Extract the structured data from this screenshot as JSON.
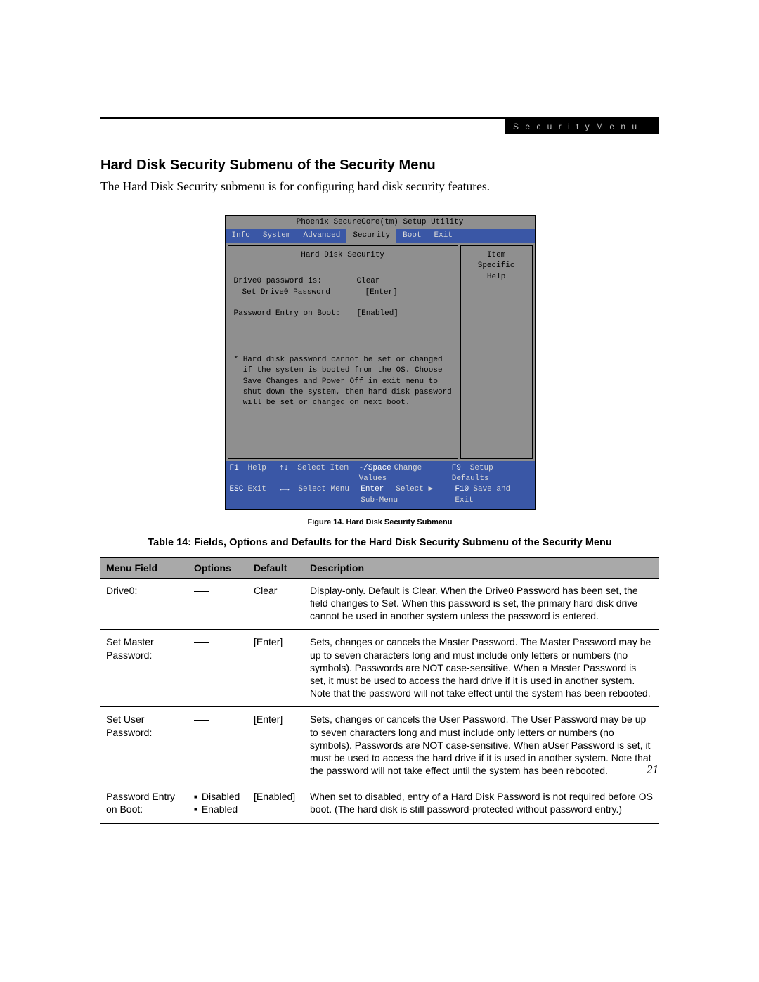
{
  "header_label": "S e c u r i t y   M e n u",
  "section_title": "Hard Disk Security Submenu of the Security Menu",
  "intro": "The Hard Disk Security submenu is for configuring hard disk security features.",
  "bios": {
    "utility_title": "Phoenix SecureCore(tm) Setup Utility",
    "tabs": [
      "Info",
      "System",
      "Advanced",
      "Security",
      "Boot",
      "Exit"
    ],
    "active_tab": "Security",
    "left_title": "Hard Disk Security",
    "right_title": "Item Specific Help",
    "rows": [
      {
        "label": "Drive0 password is:",
        "value": "Clear",
        "indent": 0
      },
      {
        "label": "Set Drive0 Password",
        "value": "[Enter]",
        "indent": 1
      },
      {
        "label": "",
        "value": "",
        "indent": 0
      },
      {
        "label": "Password Entry on Boot:",
        "value": "[Enabled]",
        "indent": 0
      }
    ],
    "note": [
      "* Hard disk password cannot be set or changed",
      "  if the system is booted from the OS. Choose",
      "  Save Changes and Power Off in exit menu to",
      "  shut down the system, then hard disk password",
      "  will be set or changed on next boot."
    ],
    "footer": {
      "r1": {
        "k1": "F1",
        "t1": "Help",
        "k2": "↑↓",
        "t2": "Select Item",
        "k3": "-/Space",
        "t3": "Change Values",
        "k4": "F9",
        "t4": "Setup Defaults"
      },
      "r2": {
        "k1": "ESC",
        "t1": "Exit",
        "k2": "←→",
        "t2": "Select Menu",
        "k3": "Enter",
        "t3": "Select ▶ Sub-Menu",
        "k4": "F10",
        "t4": "Save and Exit"
      }
    }
  },
  "figure_caption": "Figure 14.  Hard Disk Security Submenu",
  "table_title": "Table 14: Fields, Options and Defaults for the Hard Disk Security Submenu of the Security Menu",
  "table": {
    "headers": [
      "Menu Field",
      "Options",
      "Default",
      "Description"
    ],
    "rows": [
      {
        "field": "Drive0:",
        "options_type": "dash",
        "options": [],
        "default": "Clear",
        "description": "Display-only. Default is Clear. When the Drive0 Password has been set, the field changes to Set. When this password is set, the primary hard disk drive cannot be used in another system unless the password is entered."
      },
      {
        "field": "Set Master Password:",
        "options_type": "dash",
        "options": [],
        "default": "[Enter]",
        "description": "Sets, changes or cancels the Master Password. The Master Password may be up to seven characters long and must include only letters or numbers (no symbols). Passwords are NOT case-sensitive. When a Master Password is set, it must be used to access the hard drive if it is used in another system. Note that the password will not take effect until the system has been rebooted."
      },
      {
        "field": "Set User Password:",
        "options_type": "dash",
        "options": [],
        "default": "[Enter]",
        "description": "Sets, changes or cancels the User Password. The User Password may be up to seven characters long and must include only letters or numbers (no symbols). Passwords are NOT case-sensitive. When aUser Password is set, it must be used to access the hard drive if it is used in another system. Note that the password will not take effect until the system has been rebooted."
      },
      {
        "field": "Password Entry on Boot:",
        "options_type": "list",
        "options": [
          "Disabled",
          "Enabled"
        ],
        "default": "[Enabled]",
        "description": "When set to disabled, entry of a Hard Disk Password is not required before OS boot. (The hard disk is still password-protected without password entry.)"
      }
    ]
  },
  "page_number": "21"
}
